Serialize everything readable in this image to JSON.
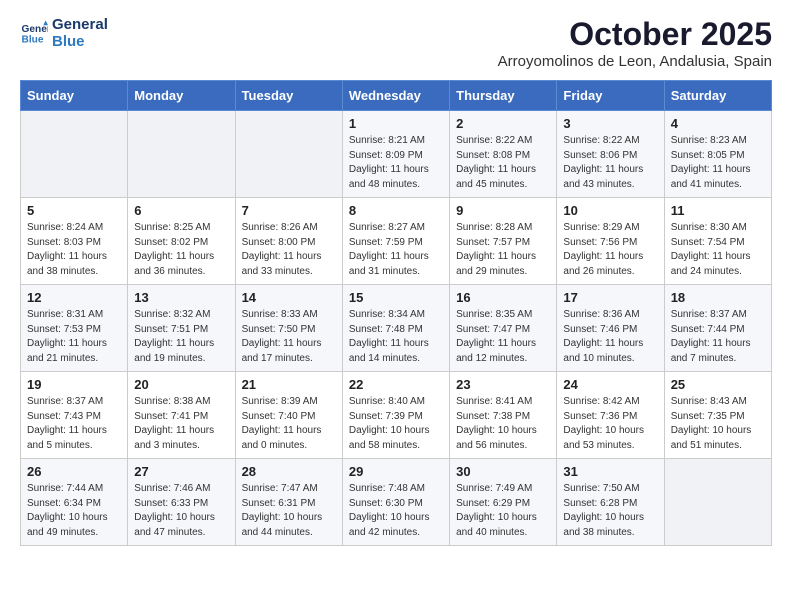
{
  "logo": {
    "line1": "General",
    "line2": "Blue"
  },
  "title": "October 2025",
  "subtitle": "Arroyomolinos de Leon, Andalusia, Spain",
  "days_of_week": [
    "Sunday",
    "Monday",
    "Tuesday",
    "Wednesday",
    "Thursday",
    "Friday",
    "Saturday"
  ],
  "weeks": [
    [
      {
        "day": "",
        "info": ""
      },
      {
        "day": "",
        "info": ""
      },
      {
        "day": "",
        "info": ""
      },
      {
        "day": "1",
        "info": "Sunrise: 8:21 AM\nSunset: 8:09 PM\nDaylight: 11 hours and 48 minutes."
      },
      {
        "day": "2",
        "info": "Sunrise: 8:22 AM\nSunset: 8:08 PM\nDaylight: 11 hours and 45 minutes."
      },
      {
        "day": "3",
        "info": "Sunrise: 8:22 AM\nSunset: 8:06 PM\nDaylight: 11 hours and 43 minutes."
      },
      {
        "day": "4",
        "info": "Sunrise: 8:23 AM\nSunset: 8:05 PM\nDaylight: 11 hours and 41 minutes."
      }
    ],
    [
      {
        "day": "5",
        "info": "Sunrise: 8:24 AM\nSunset: 8:03 PM\nDaylight: 11 hours and 38 minutes."
      },
      {
        "day": "6",
        "info": "Sunrise: 8:25 AM\nSunset: 8:02 PM\nDaylight: 11 hours and 36 minutes."
      },
      {
        "day": "7",
        "info": "Sunrise: 8:26 AM\nSunset: 8:00 PM\nDaylight: 11 hours and 33 minutes."
      },
      {
        "day": "8",
        "info": "Sunrise: 8:27 AM\nSunset: 7:59 PM\nDaylight: 11 hours and 31 minutes."
      },
      {
        "day": "9",
        "info": "Sunrise: 8:28 AM\nSunset: 7:57 PM\nDaylight: 11 hours and 29 minutes."
      },
      {
        "day": "10",
        "info": "Sunrise: 8:29 AM\nSunset: 7:56 PM\nDaylight: 11 hours and 26 minutes."
      },
      {
        "day": "11",
        "info": "Sunrise: 8:30 AM\nSunset: 7:54 PM\nDaylight: 11 hours and 24 minutes."
      }
    ],
    [
      {
        "day": "12",
        "info": "Sunrise: 8:31 AM\nSunset: 7:53 PM\nDaylight: 11 hours and 21 minutes."
      },
      {
        "day": "13",
        "info": "Sunrise: 8:32 AM\nSunset: 7:51 PM\nDaylight: 11 hours and 19 minutes."
      },
      {
        "day": "14",
        "info": "Sunrise: 8:33 AM\nSunset: 7:50 PM\nDaylight: 11 hours and 17 minutes."
      },
      {
        "day": "15",
        "info": "Sunrise: 8:34 AM\nSunset: 7:48 PM\nDaylight: 11 hours and 14 minutes."
      },
      {
        "day": "16",
        "info": "Sunrise: 8:35 AM\nSunset: 7:47 PM\nDaylight: 11 hours and 12 minutes."
      },
      {
        "day": "17",
        "info": "Sunrise: 8:36 AM\nSunset: 7:46 PM\nDaylight: 11 hours and 10 minutes."
      },
      {
        "day": "18",
        "info": "Sunrise: 8:37 AM\nSunset: 7:44 PM\nDaylight: 11 hours and 7 minutes."
      }
    ],
    [
      {
        "day": "19",
        "info": "Sunrise: 8:37 AM\nSunset: 7:43 PM\nDaylight: 11 hours and 5 minutes."
      },
      {
        "day": "20",
        "info": "Sunrise: 8:38 AM\nSunset: 7:41 PM\nDaylight: 11 hours and 3 minutes."
      },
      {
        "day": "21",
        "info": "Sunrise: 8:39 AM\nSunset: 7:40 PM\nDaylight: 11 hours and 0 minutes."
      },
      {
        "day": "22",
        "info": "Sunrise: 8:40 AM\nSunset: 7:39 PM\nDaylight: 10 hours and 58 minutes."
      },
      {
        "day": "23",
        "info": "Sunrise: 8:41 AM\nSunset: 7:38 PM\nDaylight: 10 hours and 56 minutes."
      },
      {
        "day": "24",
        "info": "Sunrise: 8:42 AM\nSunset: 7:36 PM\nDaylight: 10 hours and 53 minutes."
      },
      {
        "day": "25",
        "info": "Sunrise: 8:43 AM\nSunset: 7:35 PM\nDaylight: 10 hours and 51 minutes."
      }
    ],
    [
      {
        "day": "26",
        "info": "Sunrise: 7:44 AM\nSunset: 6:34 PM\nDaylight: 10 hours and 49 minutes."
      },
      {
        "day": "27",
        "info": "Sunrise: 7:46 AM\nSunset: 6:33 PM\nDaylight: 10 hours and 47 minutes."
      },
      {
        "day": "28",
        "info": "Sunrise: 7:47 AM\nSunset: 6:31 PM\nDaylight: 10 hours and 44 minutes."
      },
      {
        "day": "29",
        "info": "Sunrise: 7:48 AM\nSunset: 6:30 PM\nDaylight: 10 hours and 42 minutes."
      },
      {
        "day": "30",
        "info": "Sunrise: 7:49 AM\nSunset: 6:29 PM\nDaylight: 10 hours and 40 minutes."
      },
      {
        "day": "31",
        "info": "Sunrise: 7:50 AM\nSunset: 6:28 PM\nDaylight: 10 hours and 38 minutes."
      },
      {
        "day": "",
        "info": ""
      }
    ]
  ]
}
